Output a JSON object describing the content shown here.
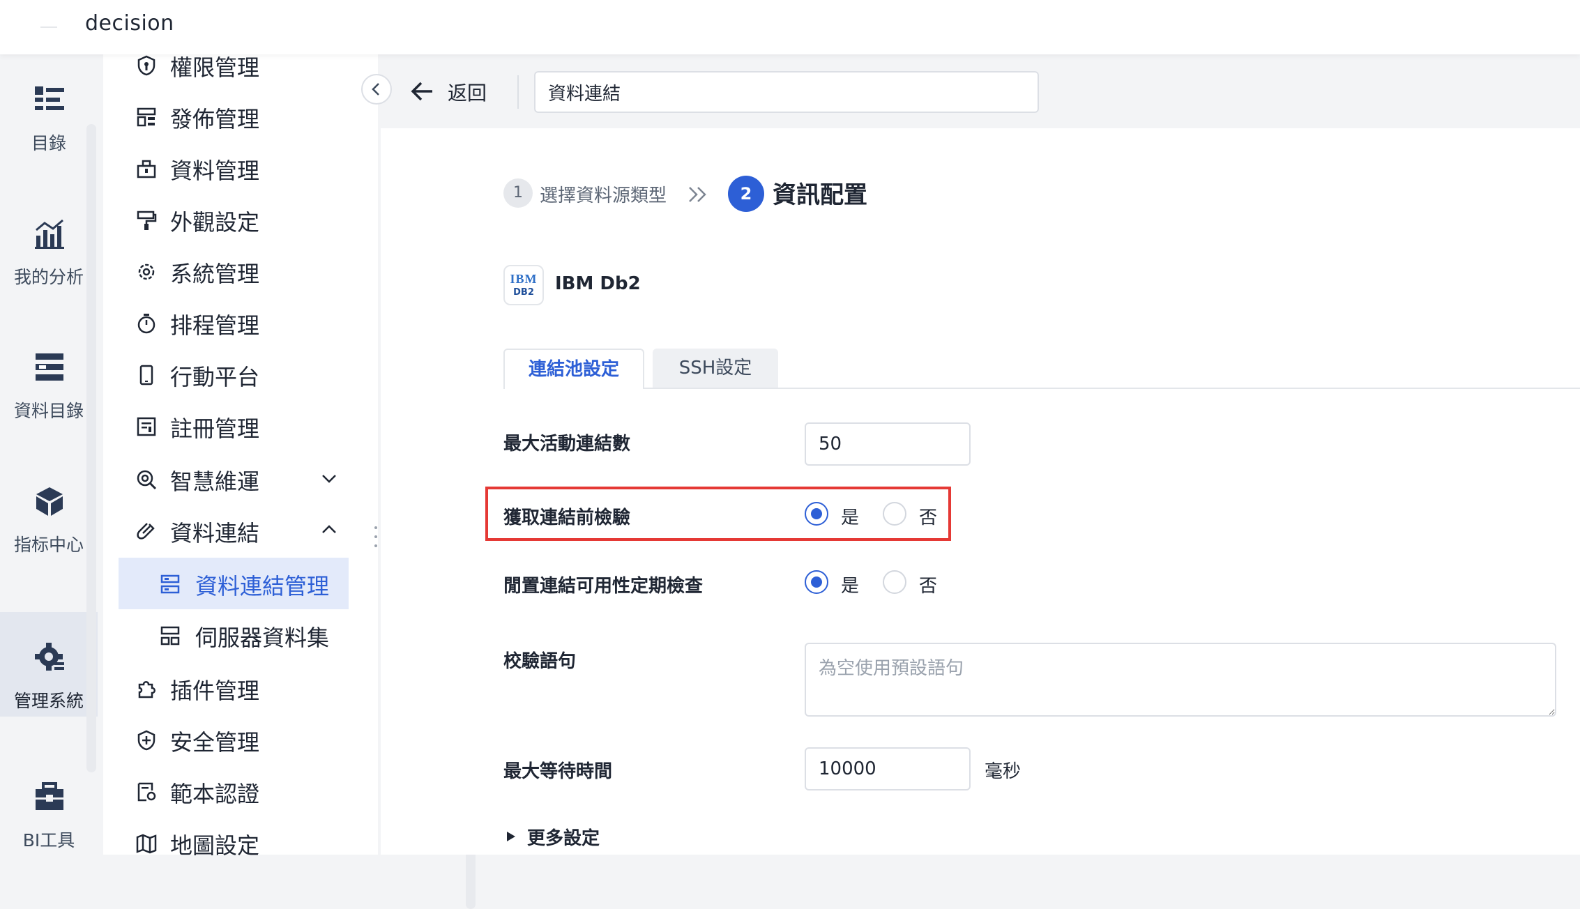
{
  "app": {
    "title": "decision"
  },
  "rail": {
    "items": [
      {
        "label": "目錄",
        "icon": "catalog-icon"
      },
      {
        "label": "我的分析",
        "icon": "analysis-chart-icon"
      },
      {
        "label": "資料目錄",
        "icon": "data-catalog-icon"
      },
      {
        "label": "指标中心",
        "icon": "cube-icon"
      },
      {
        "label": "管理系統",
        "icon": "gear-icon",
        "active": true
      },
      {
        "label": "BI工具",
        "icon": "toolbox-icon"
      }
    ]
  },
  "menu": {
    "items": [
      {
        "label": "權限管理",
        "icon": "permission-shield-icon"
      },
      {
        "label": "發佈管理",
        "icon": "publish-icon"
      },
      {
        "label": "資料管理",
        "icon": "data-manage-icon"
      },
      {
        "label": "外觀設定",
        "icon": "paint-roller-icon"
      },
      {
        "label": "系統管理",
        "icon": "settings-icon"
      },
      {
        "label": "排程管理",
        "icon": "stopwatch-icon"
      },
      {
        "label": "行動平台",
        "icon": "mobile-icon"
      },
      {
        "label": "註冊管理",
        "icon": "register-icon"
      },
      {
        "label": "智慧維運",
        "icon": "smart-ops-icon",
        "expanded": false
      },
      {
        "label": "資料連結",
        "icon": "link-icon",
        "expanded": true
      },
      {
        "label": "插件管理",
        "icon": "plugin-icon"
      },
      {
        "label": "安全管理",
        "icon": "security-shield-icon"
      },
      {
        "label": "範本認證",
        "icon": "template-cert-icon"
      },
      {
        "label": "地圖設定",
        "icon": "map-icon"
      }
    ],
    "sub_items": [
      {
        "label": "資料連結管理",
        "icon": "connection-manage-icon",
        "active": true
      },
      {
        "label": "伺服器資料集",
        "icon": "server-dataset-icon"
      }
    ]
  },
  "header": {
    "back_label": "返回",
    "connection_name": "資料連結"
  },
  "steps": [
    {
      "num": "1",
      "label": "選擇資料源類型"
    },
    {
      "num": "2",
      "label": "資訊配置"
    }
  ],
  "database": {
    "logo_top": "IBM",
    "logo_bottom": "DB2",
    "name": "IBM Db2"
  },
  "tabs": [
    {
      "label": "連結池設定",
      "active": true
    },
    {
      "label": "SSH設定",
      "active": false
    }
  ],
  "form": {
    "max_active": {
      "label": "最大活動連結數",
      "value": "50"
    },
    "test_on_borrow": {
      "label": "獲取連結前檢驗",
      "yes": "是",
      "no": "否",
      "selected": "是"
    },
    "test_while_idle": {
      "label": "閒置連結可用性定期檢查",
      "yes": "是",
      "no": "否",
      "selected": "是"
    },
    "validation_query": {
      "label": "校驗語句",
      "placeholder": "為空使用預設語句"
    },
    "max_wait": {
      "label": "最大等待時間",
      "value": "10000",
      "unit": "毫秒"
    },
    "more_settings": "更多設定"
  },
  "colors": {
    "accent": "#2d5fd6",
    "highlight_border": "#e53935",
    "active_bg": "#e3eafa"
  }
}
